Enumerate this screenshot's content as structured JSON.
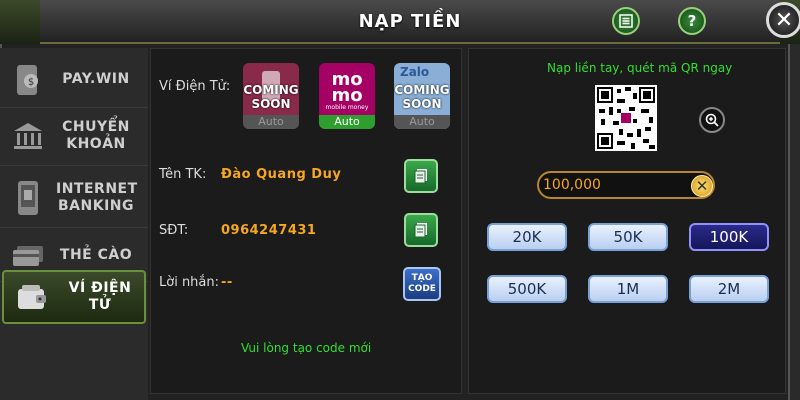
{
  "header": {
    "title": "NẠP TIỀN",
    "history_icon": "list-icon",
    "help_label": "?",
    "close_label": "✕"
  },
  "sidebar": {
    "items": [
      {
        "label": "PAY.WIN",
        "icon": "money-icon"
      },
      {
        "label": "CHUYỂN KHOẢN",
        "icon": "bank-icon"
      },
      {
        "label": "INTERNET BANKING",
        "icon": "phone-icon"
      },
      {
        "label": "THẺ CÀO",
        "icon": "card-icon"
      },
      {
        "label": "VÍ ĐIỆN TỬ",
        "icon": "wallet-icon",
        "active": true
      }
    ]
  },
  "ewallet": {
    "label": "Ví Điện Tử:",
    "options": [
      {
        "name": "coming-soon-1",
        "status": "COMING SOON",
        "foot": "Auto"
      },
      {
        "name": "momo",
        "brand_top": "mo",
        "brand_bottom": "mo",
        "tagline": "mobile money",
        "foot": "Auto",
        "color": "#a50064"
      },
      {
        "name": "zalo",
        "brand": "Zalo",
        "status": "COMING SOON",
        "foot": "Auto"
      }
    ]
  },
  "account": {
    "name_label": "Tên TK:",
    "name_value": "Đào Quang Duy"
  },
  "phone": {
    "label": "SĐT:",
    "value": "0964247431"
  },
  "message": {
    "label": "Lời nhắn:",
    "value": "--",
    "create_label_1": "TẠO",
    "create_label_2": "CODE"
  },
  "notice": "Vui lòng tạo code mới",
  "right_panel": {
    "qr_hint": "Nạp liền tay, quét mã QR ngay",
    "amount": "100,000",
    "chips": [
      "20K",
      "50K",
      "100K",
      "500K",
      "1M",
      "2M"
    ],
    "selected": "100K"
  }
}
